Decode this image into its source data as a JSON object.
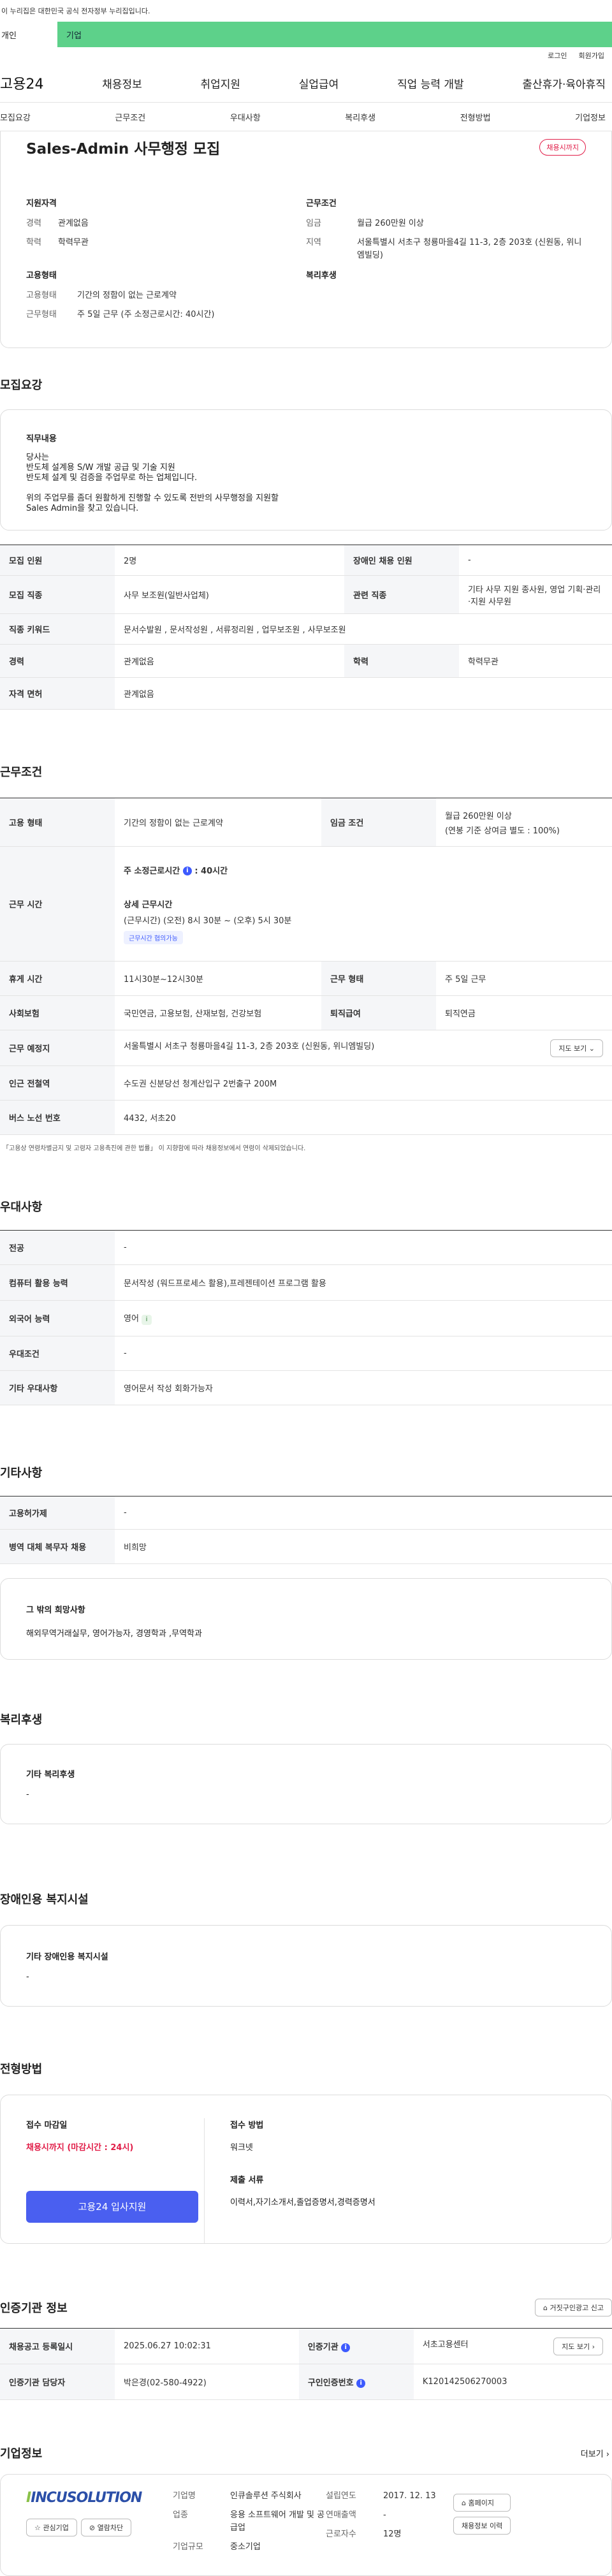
{
  "gov_banner": "이 누리집은 대한민국 공식 전자정부 누리집입니다.",
  "user_tabs": {
    "individual": "개인",
    "company": "기업"
  },
  "util": {
    "login": "로그인",
    "signup": "회원가입"
  },
  "gnb": {
    "logo": "고용24",
    "items": [
      "채용정보",
      "취업지원",
      "실업급여",
      "직업 능력 개발",
      "출산휴가·육아휴직"
    ]
  },
  "subnav": [
    "모집요강",
    "근무조건",
    "우대사항",
    "복리후생",
    "전형방법",
    "기업정보"
  ],
  "summary": {
    "title": "Sales-Admin 사무행정 모집",
    "badge": "채용시까지",
    "qual_title": "지원자격",
    "career_label": "경력",
    "career": "관계없음",
    "edu_label": "학력",
    "edu": "학력무관",
    "emp_title": "고용형태",
    "emp_type_label": "고용형태",
    "emp_type": "기간의 정함이 없는 근로계약",
    "work_type_label": "근무형태",
    "work_type": "주 5일 근무 (주 소정근로시간: 40시간)",
    "cond_title": "근무조건",
    "wage_label": "임금",
    "wage": "월급 260만원 이상",
    "region_label": "지역",
    "region": "서울특별시 서초구 청룡마을4길 11-3, 2층 203호 (신원동, 위니엠빌딩)",
    "welfare_title": "복리후생"
  },
  "recruit": {
    "title": "모집요강",
    "duty_title": "직무내용",
    "duty_lines": [
      "당사는",
      "반도체 설계용 S/W 개발 공급 및 기술 지원",
      "반도체 설계 및 검증을 주업무로 하는 업체입니다.",
      "",
      "위의 주업무를 좀더 원활하게 진행할 수 있도록 전반의 사무행정을 지원할",
      "Sales Admin을 찾고 있습니다."
    ],
    "rows": [
      [
        "모집 인원",
        "2명",
        "장애인 채용 인원",
        "-"
      ],
      [
        "모집 직종",
        "사무 보조원(일반사업체)",
        "관련 직종",
        "기타 사무 지원 종사원, 영업 기획·관리·지원 사무원"
      ],
      [
        "직종 키워드",
        "문서수발원 , 문서작성원 , 서류정리원 , 업무보조원 , 사무보조원"
      ],
      [
        "경력",
        "관계없음",
        "학력",
        "학력무관"
      ],
      [
        "자격 면허",
        "관계없음"
      ]
    ]
  },
  "conditions": {
    "title": "근무조건",
    "emp_label": "고용 형태",
    "emp": "기간의 정함이 없는 근로계약",
    "wage_label": "임금 조건",
    "wage": "월급 260만원 이상",
    "wage_sub": "(연봉 기준 상여금 별도 : 100%)",
    "hours_label": "근무 시간",
    "hours_main": "주 소정근로시간",
    "hours_value": ": 40시간",
    "hours_detail_title": "상세 근무시간",
    "hours_detail": "(근무시간) (오전) 8시 30분 ~ (오후) 5시 30분",
    "hours_chip": "근무시간 협의가능",
    "break_label": "휴게 시간",
    "break": "11시30분~12시30분",
    "form_label": "근무 형태",
    "form": "주 5일 근무",
    "ins_label": "사회보험",
    "ins": "국민연금, 고용보험, 산재보험, 건강보험",
    "ret_label": "퇴직급여",
    "ret": "퇴직연금",
    "loc_label": "근무 예정지",
    "loc": "서울특별시 서초구 청룡마을4길 11-3, 2층 203호 (신원동, 위니엠빌딩)",
    "map_btn": "지도 보기",
    "station_label": "인근 전철역",
    "station": "수도권 신분당선 청계산입구 2번출구 200M",
    "bus_label": "버스 노선 번호",
    "bus": "4432, 서초20",
    "notice": "「고용상 연령차별금지 및 고령자 고용촉진에 관한 법률」 이 지향함에 따라 채용정보에서 연령이 삭제되었습니다."
  },
  "pref": {
    "title": "우대사항",
    "rows": [
      [
        "전공",
        "-"
      ],
      [
        "컴퓨터 활용 능력",
        "문서작성 (워드프로세스 활용),프레젠테이션 프로그램 활용"
      ],
      [
        "외국어 능력",
        "영어"
      ],
      [
        "우대조건",
        "-"
      ],
      [
        "기타 우대사항",
        "영어문서 작성 회화가능자"
      ]
    ]
  },
  "etc": {
    "title": "기타사항",
    "rows": [
      [
        "고용허가제",
        "-"
      ],
      [
        "병역 대체 복무자 채용",
        "비희망"
      ]
    ],
    "hope_title": "그 밖의 희망사항",
    "hope": "해외무역거래실무, 영어가능자, 경영학과 ,무역학과"
  },
  "welfare": {
    "title": "복리후생",
    "box_title": "기타 복리후생",
    "box_value": "-"
  },
  "disab": {
    "title": "장애인용 복지시설",
    "box_title": "기타 장애인용 복지시설",
    "box_value": "-"
  },
  "process": {
    "title": "전형방법",
    "deadline_label": "접수 마감일",
    "deadline": "채용시까지 (마감시간 : 24시)",
    "apply_btn": "고용24 입사지원",
    "method_label": "접수 방법",
    "method": "워크넷",
    "docs_label": "제출 서류",
    "docs": "이력서,자기소개서,졸업증명서,경력증명서"
  },
  "agency": {
    "title": "인증기관 정보",
    "report_btn": "거짓구인광고 신고",
    "reg_label": "채용공고 등록일시",
    "reg": "2025.06.27 10:02:31",
    "org_label": "인증기관",
    "org": "서초고용센터",
    "map_btn": "지도 보기",
    "mgr_label": "인증기관 담당자",
    "mgr": "박은경(02-580-4922)",
    "num_label": "구인인증번호",
    "num": "K120142506270003"
  },
  "company": {
    "title": "기업정보",
    "more": "더보기",
    "logo_text": "INCUSOLUTION",
    "fav_btn": "관심기업",
    "block_btn": "열람차단",
    "home_btn": "홈페이지",
    "info_btn": "채용정보 이력",
    "name_label": "기업명",
    "name": "인큐솔루션 주식회사",
    "ind_label": "업종",
    "ind": "응용 소프트웨어 개발 및 공급업",
    "size_label": "기업규모",
    "size": "중소기업",
    "est_label": "설립연도",
    "est": "2017. 12. 13",
    "sales_label": "연매출액",
    "sales": "-",
    "emp_label": "근로자수",
    "emp": "12명"
  }
}
